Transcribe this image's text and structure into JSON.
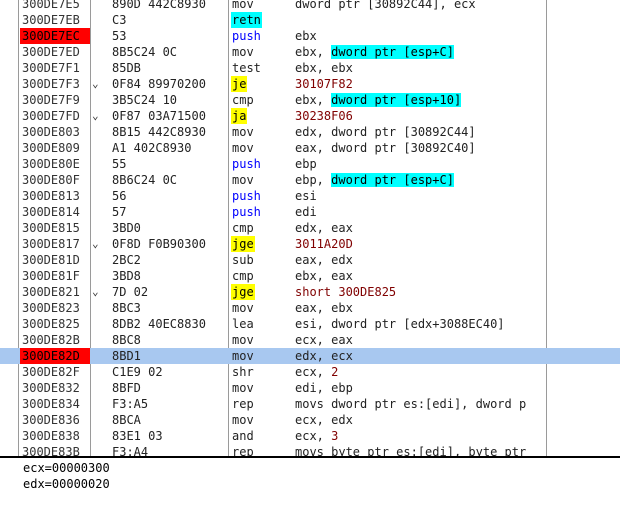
{
  "disassembly": {
    "rows": [
      {
        "addr": "300DE7E5",
        "hex": "890D 442C8930",
        "mnem": "mov",
        "mtype": "normal",
        "ops": [
          {
            "t": "dword ptr [30892C44], ecx",
            "k": "t"
          }
        ]
      },
      {
        "addr": "300DE7EB",
        "hex": "C3",
        "mnem": "retn",
        "mtype": "ret",
        "ops": []
      },
      {
        "addr": "300DE7EC",
        "hex": "53",
        "mnem": "push",
        "mtype": "call",
        "ops": [
          {
            "t": "ebx",
            "k": "t"
          }
        ],
        "bp": true
      },
      {
        "addr": "300DE7ED",
        "hex": "8B5C24 0C",
        "mnem": "mov",
        "mtype": "normal",
        "ops": [
          {
            "t": "ebx, ",
            "k": "t"
          },
          {
            "t": "dword ptr [esp+C]",
            "k": "m"
          }
        ]
      },
      {
        "addr": "300DE7F1",
        "hex": "85DB",
        "mnem": "test",
        "mtype": "normal",
        "ops": [
          {
            "t": "ebx, ebx",
            "k": "t"
          }
        ]
      },
      {
        "addr": "300DE7F3",
        "hex": "0F84 89970200",
        "mnem": "je",
        "mtype": "jmp",
        "ops": [
          {
            "t": "30107F82",
            "k": "j"
          }
        ],
        "arrow": "⌄"
      },
      {
        "addr": "300DE7F9",
        "hex": "3B5C24 10",
        "mnem": "cmp",
        "mtype": "normal",
        "ops": [
          {
            "t": "ebx, ",
            "k": "t"
          },
          {
            "t": "dword ptr [esp+10]",
            "k": "m"
          }
        ]
      },
      {
        "addr": "300DE7FD",
        "hex": "0F87 03A71500",
        "mnem": "ja",
        "mtype": "jmp",
        "ops": [
          {
            "t": "30238F06",
            "k": "j"
          }
        ],
        "arrow": "⌄"
      },
      {
        "addr": "300DE803",
        "hex": "8B15 442C8930",
        "mnem": "mov",
        "mtype": "normal",
        "ops": [
          {
            "t": "edx, dword ptr [30892C44]",
            "k": "t"
          }
        ]
      },
      {
        "addr": "300DE809",
        "hex": "A1 402C8930",
        "mnem": "mov",
        "mtype": "normal",
        "ops": [
          {
            "t": "eax, dword ptr [30892C40]",
            "k": "t"
          }
        ]
      },
      {
        "addr": "300DE80E",
        "hex": "55",
        "mnem": "push",
        "mtype": "call",
        "ops": [
          {
            "t": "ebp",
            "k": "t"
          }
        ]
      },
      {
        "addr": "300DE80F",
        "hex": "8B6C24 0C",
        "mnem": "mov",
        "mtype": "normal",
        "ops": [
          {
            "t": "ebp, ",
            "k": "t"
          },
          {
            "t": "dword ptr [esp+C]",
            "k": "m"
          }
        ]
      },
      {
        "addr": "300DE813",
        "hex": "56",
        "mnem": "push",
        "mtype": "call",
        "ops": [
          {
            "t": "esi",
            "k": "t"
          }
        ]
      },
      {
        "addr": "300DE814",
        "hex": "57",
        "mnem": "push",
        "mtype": "call",
        "ops": [
          {
            "t": "edi",
            "k": "t"
          }
        ]
      },
      {
        "addr": "300DE815",
        "hex": "3BD0",
        "mnem": "cmp",
        "mtype": "normal",
        "ops": [
          {
            "t": "edx, eax",
            "k": "t"
          }
        ]
      },
      {
        "addr": "300DE817",
        "hex": "0F8D F0B90300",
        "mnem": "jge",
        "mtype": "jmp",
        "ops": [
          {
            "t": "3011A20D",
            "k": "j"
          }
        ],
        "arrow": "⌄"
      },
      {
        "addr": "300DE81D",
        "hex": "2BC2",
        "mnem": "sub",
        "mtype": "normal",
        "ops": [
          {
            "t": "eax, edx",
            "k": "t"
          }
        ]
      },
      {
        "addr": "300DE81F",
        "hex": "3BD8",
        "mnem": "cmp",
        "mtype": "normal",
        "ops": [
          {
            "t": "ebx, eax",
            "k": "t"
          }
        ]
      },
      {
        "addr": "300DE821",
        "hex": "7D 02",
        "mnem": "jge",
        "mtype": "jmp",
        "ops": [
          {
            "t": "short 300DE825",
            "k": "j"
          }
        ],
        "arrow": "⌄"
      },
      {
        "addr": "300DE823",
        "hex": "8BC3",
        "mnem": "mov",
        "mtype": "normal",
        "ops": [
          {
            "t": "eax, ebx",
            "k": "t"
          }
        ]
      },
      {
        "addr": "300DE825",
        "hex": "8DB2 40EC8830",
        "mnem": "lea",
        "mtype": "normal",
        "ops": [
          {
            "t": "esi, dword ptr [edx+3088EC40]",
            "k": "t"
          }
        ]
      },
      {
        "addr": "300DE82B",
        "hex": "8BC8",
        "mnem": "mov",
        "mtype": "normal",
        "ops": [
          {
            "t": "ecx, eax",
            "k": "t"
          }
        ]
      },
      {
        "addr": "300DE82D",
        "hex": "8BD1",
        "mnem": "mov",
        "mtype": "normal",
        "ops": [
          {
            "t": "edx, ecx",
            "k": "t"
          }
        ],
        "bp": true,
        "current": true
      },
      {
        "addr": "300DE82F",
        "hex": "C1E9 02",
        "mnem": "shr",
        "mtype": "normal",
        "ops": [
          {
            "t": "ecx, ",
            "k": "t"
          },
          {
            "t": "2",
            "k": "n"
          }
        ]
      },
      {
        "addr": "300DE832",
        "hex": "8BFD",
        "mnem": "mov",
        "mtype": "normal",
        "ops": [
          {
            "t": "edi, ebp",
            "k": "t"
          }
        ]
      },
      {
        "addr": "300DE834",
        "hex": "F3:A5",
        "mnem": "rep",
        "mtype": "normal",
        "ops": [
          {
            "t": "movs dword ptr es:[edi], dword p",
            "k": "t"
          }
        ]
      },
      {
        "addr": "300DE836",
        "hex": "8BCA",
        "mnem": "mov",
        "mtype": "normal",
        "ops": [
          {
            "t": "ecx, edx",
            "k": "t"
          }
        ]
      },
      {
        "addr": "300DE838",
        "hex": "83E1 03",
        "mnem": "and",
        "mtype": "normal",
        "ops": [
          {
            "t": "ecx, ",
            "k": "t"
          },
          {
            "t": "3",
            "k": "n"
          }
        ]
      },
      {
        "addr": "300DE83B",
        "hex": "F3:A4",
        "mnem": "rep",
        "mtype": "normal",
        "ops": [
          {
            "t": "movs byte ptr es:[edi], byte ptr",
            "k": "t"
          }
        ]
      }
    ]
  },
  "info_pane": {
    "lines": [
      "ecx=00000300",
      "edx=00000020"
    ]
  },
  "colors": {
    "breakpoint": "#ff0000",
    "current_line": "#a8c8f0",
    "call_mnemonic": "#0000ff",
    "jump_highlight": "#ffff00",
    "memory_operand_highlight": "#00ffff",
    "jump_target": "#800000"
  }
}
